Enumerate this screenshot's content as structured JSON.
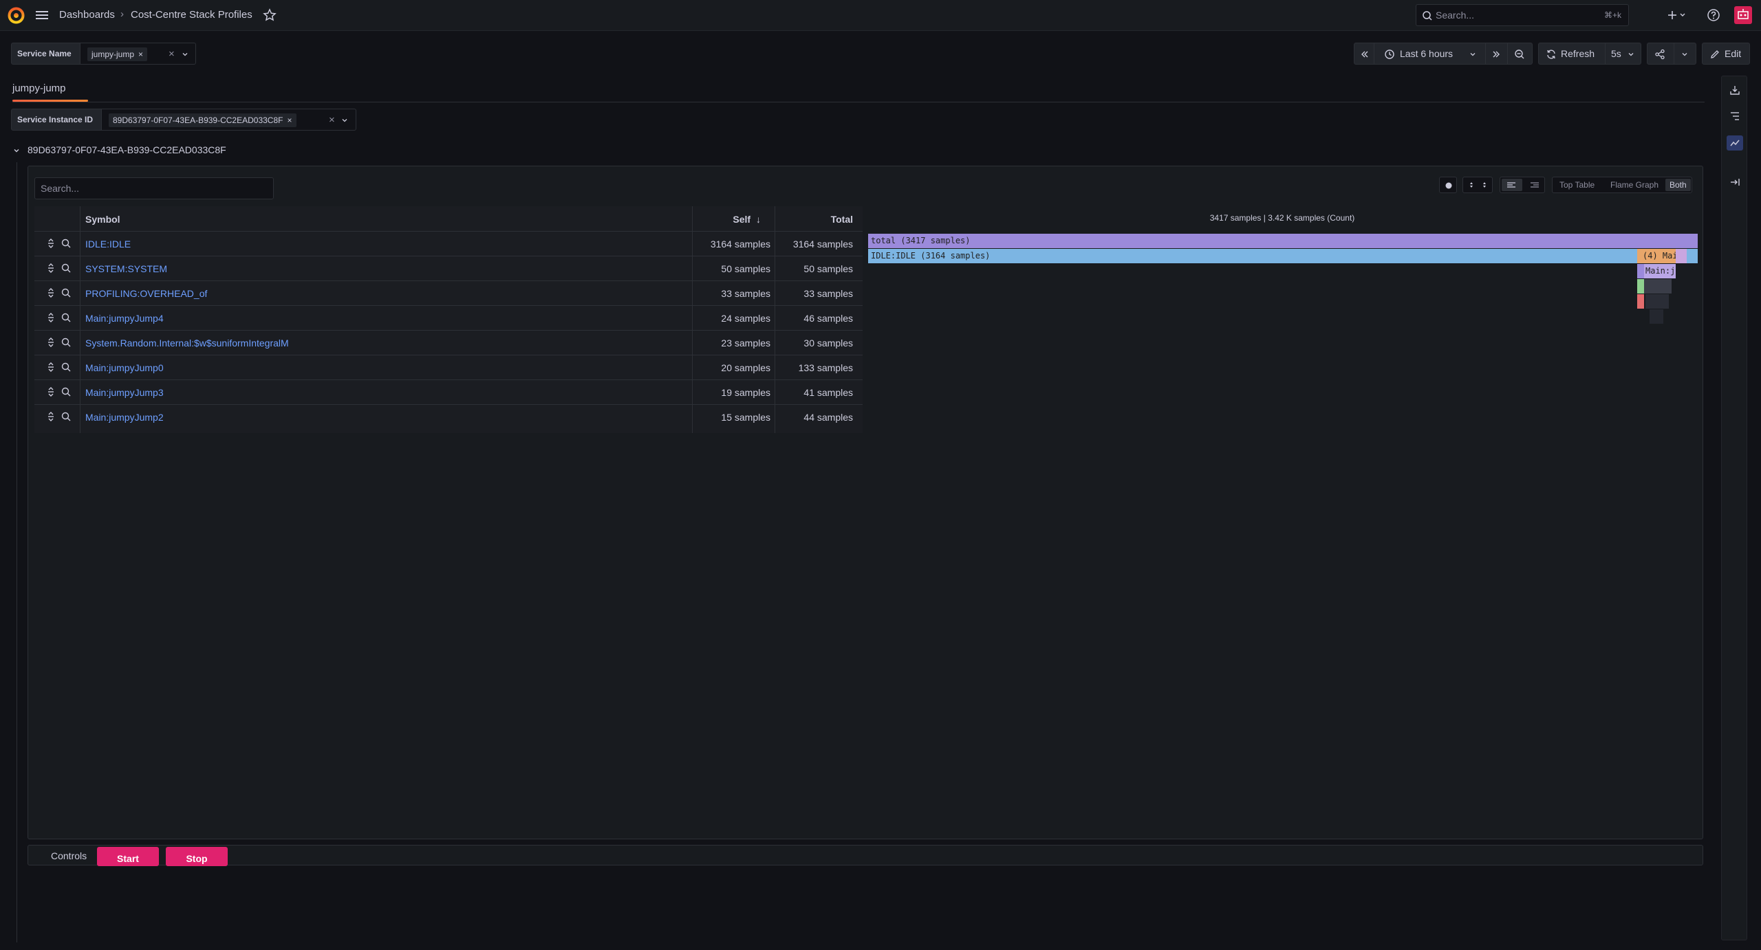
{
  "topbar": {
    "breadcrumb": [
      "Dashboards",
      "Cost-Centre Stack Profiles"
    ],
    "search_placeholder": "Search...",
    "search_shortcut": "⌘+k"
  },
  "variables": {
    "service_name": {
      "label": "Service Name",
      "value": "jumpy-jump"
    },
    "service_instance": {
      "label": "Service Instance ID",
      "value": "89D63797-0F07-43EA-B939-CC2EAD033C8F"
    }
  },
  "toolbar": {
    "time_range": "Last 6 hours",
    "refresh_label": "Refresh",
    "refresh_interval": "5s",
    "edit_label": "Edit"
  },
  "tabs": [
    {
      "label": "jumpy-jump",
      "active": true
    }
  ],
  "row": {
    "title": "89D63797-0F07-43EA-B939-CC2EAD033C8F"
  },
  "panel": {
    "search_placeholder": "Search...",
    "view_modes": [
      "Top Table",
      "Flame Graph",
      "Both"
    ],
    "active_view": "Both",
    "table": {
      "columns": [
        "Symbol",
        "Self",
        "Total"
      ],
      "sort": "Self descending",
      "rows": [
        {
          "symbol": "IDLE:IDLE",
          "self": "3164 samples",
          "total": "3164 samples"
        },
        {
          "symbol": "SYSTEM:SYSTEM",
          "self": "50 samples",
          "total": "50 samples"
        },
        {
          "symbol": "PROFILING:OVERHEAD_of",
          "self": "33 samples",
          "total": "33 samples"
        },
        {
          "symbol": "Main:jumpyJump4",
          "self": "24 samples",
          "total": "46 samples"
        },
        {
          "symbol": "System.Random.Internal:$w$suniformIntegralM",
          "self": "23 samples",
          "total": "30 samples"
        },
        {
          "symbol": "Main:jumpyJump0",
          "self": "20 samples",
          "total": "133 samples"
        },
        {
          "symbol": "Main:jumpyJump3",
          "self": "19 samples",
          "total": "41 samples"
        },
        {
          "symbol": "Main:jumpyJump2",
          "self": "15 samples",
          "total": "44 samples"
        }
      ]
    },
    "flamegraph": {
      "summary": "3417 samples | 3.42 K samples (Count)",
      "total_label": "total (3417 samples)",
      "idle_label": "IDLE:IDLE (3164 samples)",
      "other_label": "(4) Mai",
      "main_label": "Main:j",
      "colors": {
        "total": "#9b8adb",
        "idle": "#7cb5e3",
        "orange": "#e8a66a"
      }
    }
  },
  "controls": {
    "label": "Controls",
    "start": "Start",
    "stop": "Stop"
  }
}
